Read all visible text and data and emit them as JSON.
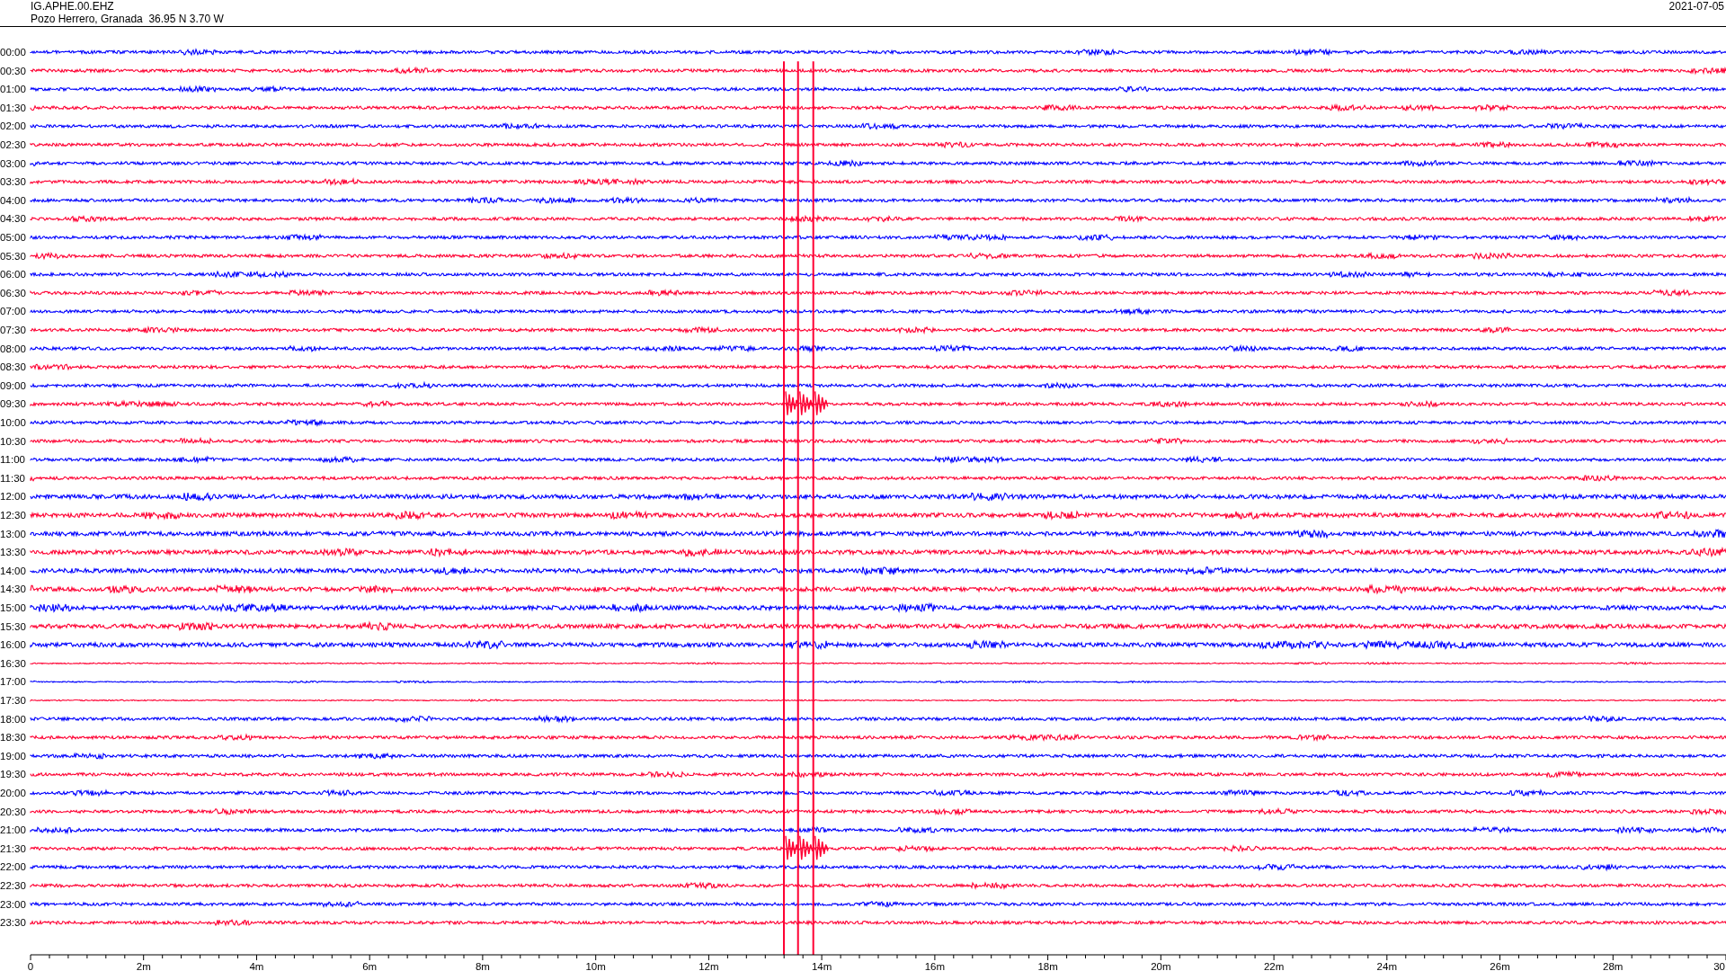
{
  "header": {
    "station": "IG.APHE.00.EHZ",
    "location": "Pozo Herrero, Granada  36.95 N 3.70 W",
    "date": "2021-07-05"
  },
  "rows": [
    {
      "time": "00:00",
      "color": "#0000ff"
    },
    {
      "time": "00:30",
      "color": "#ff0033"
    },
    {
      "time": "01:00",
      "color": "#0000ff"
    },
    {
      "time": "01:30",
      "color": "#ff0033"
    },
    {
      "time": "02:00",
      "color": "#0000ff"
    },
    {
      "time": "02:30",
      "color": "#ff0033"
    },
    {
      "time": "03:00",
      "color": "#0000ff"
    },
    {
      "time": "03:30",
      "color": "#ff0033"
    },
    {
      "time": "04:00",
      "color": "#0000ff"
    },
    {
      "time": "04:30",
      "color": "#ff0033"
    },
    {
      "time": "05:00",
      "color": "#0000ff"
    },
    {
      "time": "05:30",
      "color": "#ff0033"
    },
    {
      "time": "06:00",
      "color": "#0000ff"
    },
    {
      "time": "06:30",
      "color": "#ff0033"
    },
    {
      "time": "07:00",
      "color": "#0000ff"
    },
    {
      "time": "07:30",
      "color": "#ff0033"
    },
    {
      "time": "08:00",
      "color": "#0000ff"
    },
    {
      "time": "08:30",
      "color": "#ff0033"
    },
    {
      "time": "09:00",
      "color": "#0000ff"
    },
    {
      "time": "09:30",
      "color": "#ff0033"
    },
    {
      "time": "10:00",
      "color": "#0000ff"
    },
    {
      "time": "10:30",
      "color": "#ff0033"
    },
    {
      "time": "11:00",
      "color": "#0000ff"
    },
    {
      "time": "11:30",
      "color": "#ff0033"
    },
    {
      "time": "12:00",
      "color": "#0000ff"
    },
    {
      "time": "12:30",
      "color": "#ff0033"
    },
    {
      "time": "13:00",
      "color": "#0000ff"
    },
    {
      "time": "13:30",
      "color": "#ff0033"
    },
    {
      "time": "14:00",
      "color": "#0000ff"
    },
    {
      "time": "14:30",
      "color": "#ff0033"
    },
    {
      "time": "15:00",
      "color": "#0000ff"
    },
    {
      "time": "15:30",
      "color": "#ff0033"
    },
    {
      "time": "16:00",
      "color": "#0000ff"
    },
    {
      "time": "16:30",
      "color": "#ff0033"
    },
    {
      "time": "17:00",
      "color": "#0000ff"
    },
    {
      "time": "17:30",
      "color": "#ff0033"
    },
    {
      "time": "18:00",
      "color": "#0000ff"
    },
    {
      "time": "18:30",
      "color": "#ff0033"
    },
    {
      "time": "19:00",
      "color": "#0000ff"
    },
    {
      "time": "19:30",
      "color": "#ff0033"
    },
    {
      "time": "20:00",
      "color": "#0000ff"
    },
    {
      "time": "20:30",
      "color": "#ff0033"
    },
    {
      "time": "21:00",
      "color": "#0000ff"
    },
    {
      "time": "21:30",
      "color": "#ff0033"
    },
    {
      "time": "22:00",
      "color": "#0000ff"
    },
    {
      "time": "22:30",
      "color": "#ff0033"
    },
    {
      "time": "23:00",
      "color": "#0000ff"
    },
    {
      "time": "23:30",
      "color": "#ff0033"
    }
  ],
  "x_axis": {
    "ticks": [
      "0",
      "2m",
      "4m",
      "6m",
      "8m",
      "10m",
      "12m",
      "14m",
      "16m",
      "18m",
      "20m",
      "22m",
      "24m",
      "26m",
      "28m",
      "30"
    ]
  }
}
